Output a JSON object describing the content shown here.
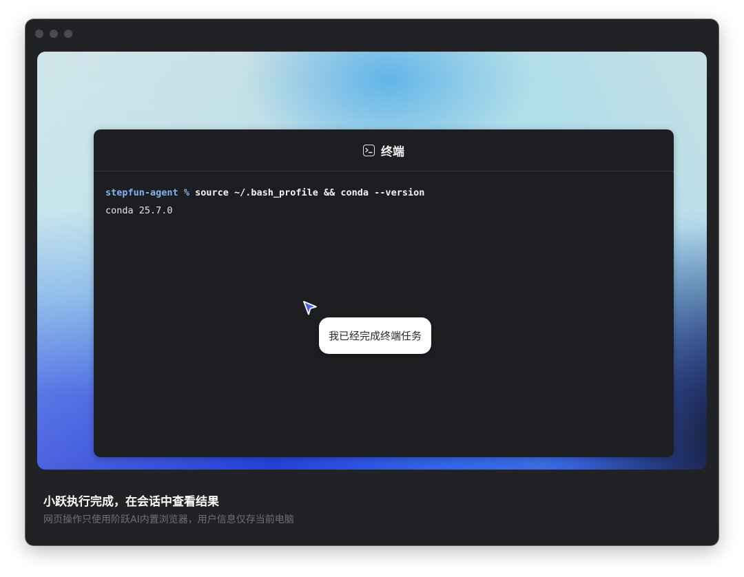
{
  "window": {
    "traffic_lights": [
      "close",
      "minimize",
      "maximize"
    ]
  },
  "terminal": {
    "title": "终端",
    "title_icon": "terminal-icon",
    "lines": [
      {
        "prompt_user": "stepfun-agent",
        "prompt_symbol": "%",
        "command": "source ~/.bash_profile && conda --version"
      },
      {
        "output": "conda 25.7.0"
      }
    ]
  },
  "agent": {
    "cursor_icon": "pointer-cursor-icon",
    "message": "我已经完成终端任务"
  },
  "footer": {
    "title": "小跃执行完成，在会话中查看结果",
    "subtitle": "网页操作只使用阶跃AI内置浏览器，用户信息仅存当前电脑"
  },
  "colors": {
    "prompt": "#7fb4f4",
    "window_bg": "#212226",
    "terminal_bg": "#1d1e21",
    "cursor": "#4c5ef0"
  }
}
